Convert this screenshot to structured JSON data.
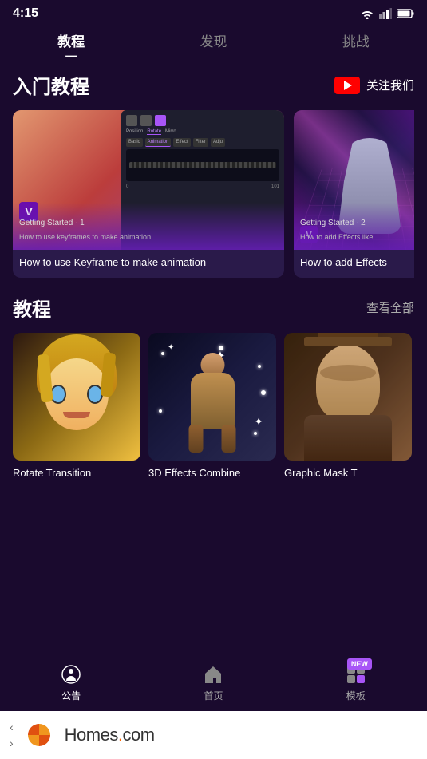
{
  "statusBar": {
    "time": "4:15"
  },
  "topNav": {
    "tabs": [
      {
        "id": "tutorial",
        "label": "教程",
        "active": true
      },
      {
        "id": "discover",
        "label": "发现",
        "active": false
      },
      {
        "id": "challenge",
        "label": "挑战",
        "active": false
      }
    ]
  },
  "beginnerSection": {
    "title": "入门教程",
    "followButton": "关注我们",
    "cards": [
      {
        "id": "keyframe",
        "tag": "Getting Started · 1",
        "subtitle": "How to use keyframes to make animation",
        "title": "How to use Keyframe to make animation"
      },
      {
        "id": "effects",
        "tag": "Getting Started · 2",
        "subtitle": "How to add Effects like",
        "title": "How to add Effects"
      }
    ]
  },
  "tutorialSection": {
    "title": "教程",
    "viewAll": "查看全部",
    "items": [
      {
        "id": "rotate",
        "label": "Rotate Transition"
      },
      {
        "id": "3d",
        "label": "3D Effects Combine"
      },
      {
        "id": "graphic",
        "label": "Graphic Mask T"
      }
    ]
  },
  "bottomNav": {
    "items": [
      {
        "id": "announce",
        "label": "公告",
        "active": true
      },
      {
        "id": "home",
        "label": "首页",
        "active": false
      },
      {
        "id": "template",
        "label": "模板",
        "active": false,
        "badge": "NEW"
      }
    ]
  },
  "adBanner": {
    "brand": "Homes",
    "tld": ".com"
  }
}
